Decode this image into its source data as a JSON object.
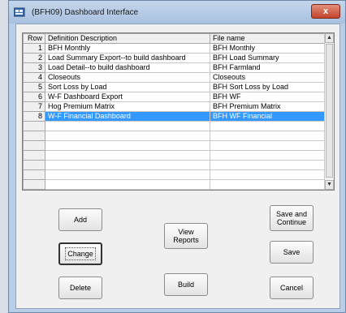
{
  "window": {
    "title": "(BFH09)  Dashboard Interface",
    "close_symbol": "x"
  },
  "grid": {
    "columns": [
      "Row",
      "Definition Description",
      "File name"
    ],
    "rows": [
      {
        "row": "1",
        "description": "BFH Monthly",
        "file": "BFH Monthly"
      },
      {
        "row": "2",
        "description": "Load Summary Export--to build dashboard",
        "file": "BFH Load Summary"
      },
      {
        "row": "3",
        "description": "Load Detail--to build dashboard",
        "file": "BFH Farmland"
      },
      {
        "row": "4",
        "description": "Closeouts",
        "file": "Closeouts"
      },
      {
        "row": "5",
        "description": "Sort Loss by Load",
        "file": "BFH Sort Loss by Load"
      },
      {
        "row": "6",
        "description": "W-F Dashboard Export",
        "file": "BFH WF"
      },
      {
        "row": "7",
        "description": "Hog Premium Matrix",
        "file": "BFH Premium Matrix"
      },
      {
        "row": "8",
        "description": "W-F Financial Dashboard",
        "file": "BFH WF Financial"
      }
    ],
    "selected_row": "8",
    "scroll_up_icon": "up-arrow-icon",
    "scroll_down_icon": "down-arrow-icon"
  },
  "buttons": {
    "add": "Add",
    "change": "Change",
    "delete": "Delete",
    "view_reports": "View\nReports",
    "build": "Build",
    "save_and_continue": "Save and\nContinue",
    "save": "Save",
    "cancel": "Cancel"
  }
}
